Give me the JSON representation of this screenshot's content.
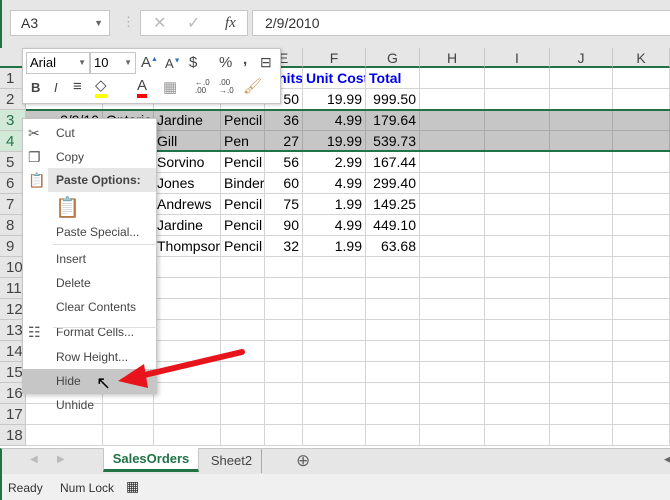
{
  "formula_bar": {
    "name_box": "A3",
    "cancel_icon": "✕",
    "enter_icon": "✓",
    "fx_label": "fx",
    "formula": "2/9/2010"
  },
  "columns": [
    "E",
    "F",
    "G",
    "H",
    "I",
    "J",
    "K"
  ],
  "rows": [
    "1",
    "2",
    "3",
    "4",
    "5",
    "6",
    "7",
    "8",
    "9",
    "10",
    "11",
    "12",
    "13",
    "14",
    "15",
    "16",
    "17",
    "18"
  ],
  "selected_rows": [
    "3",
    "4"
  ],
  "cells": {
    "r1": {
      "E": "Units",
      "F": "Unit Cost",
      "G": "Total"
    },
    "r2": {
      "E": "50",
      "F": "19.99",
      "G": "999.50"
    },
    "r3": {
      "A": "2/9/10",
      "B": "Ontario",
      "C": "Jardine",
      "D": "Pencil",
      "E": "36",
      "F": "4.99",
      "G": "179.64"
    },
    "r4": {
      "C": "Gill",
      "D": "Pen",
      "E": "27",
      "F": "19.99",
      "G": "539.73"
    },
    "r5": {
      "C": "Sorvino",
      "D": "Pencil",
      "E": "56",
      "F": "2.99",
      "G": "167.44"
    },
    "r6": {
      "C": "Jones",
      "D": "Binder",
      "E": "60",
      "F": "4.99",
      "G": "299.40"
    },
    "r7": {
      "C": "Andrews",
      "D": "Pencil",
      "E": "75",
      "F": "1.99",
      "G": "149.25"
    },
    "r8": {
      "C": "Jardine",
      "D": "Pencil",
      "E": "90",
      "F": "4.99",
      "G": "449.10"
    },
    "r9": {
      "C": "Thompson",
      "D": "Pencil",
      "E": "32",
      "F": "1.99",
      "G": "63.68"
    }
  },
  "mini_toolbar": {
    "font": "Arial",
    "size": "10",
    "currency": "$",
    "percent": "%",
    "comma": ",",
    "bold": "B",
    "italic": "I",
    "font_color_letter": "A",
    "highlight_color": "#ffff00",
    "font_color": "#ff0000",
    "inc_decimal": "←.0 .00",
    "dec_decimal": ".00 →.0"
  },
  "context_menu": {
    "items": [
      {
        "label": "Cut",
        "icon": "scissors-icon"
      },
      {
        "label": "Copy",
        "icon": "copy-icon"
      },
      {
        "label": "Paste Options:",
        "icon": "paste-icon"
      },
      {
        "label": "Paste Special..."
      },
      {
        "label": "Insert"
      },
      {
        "label": "Delete"
      },
      {
        "label": "Clear Contents"
      },
      {
        "label": "Format Cells...",
        "icon": "format-cells-icon"
      },
      {
        "label": "Row Height..."
      },
      {
        "label": "Hide"
      },
      {
        "label": "Unhide"
      }
    ],
    "highlighted": "Hide"
  },
  "sheet_tabs": [
    {
      "label": "SalesOrders",
      "active": true
    },
    {
      "label": "Sheet2",
      "active": false
    }
  ],
  "status_bar": {
    "ready": "Ready",
    "num_lock": "Num Lock"
  },
  "colors": {
    "excel_green": "#217346",
    "header_blue": "#0000ee",
    "arrow_red": "#e8141b"
  }
}
